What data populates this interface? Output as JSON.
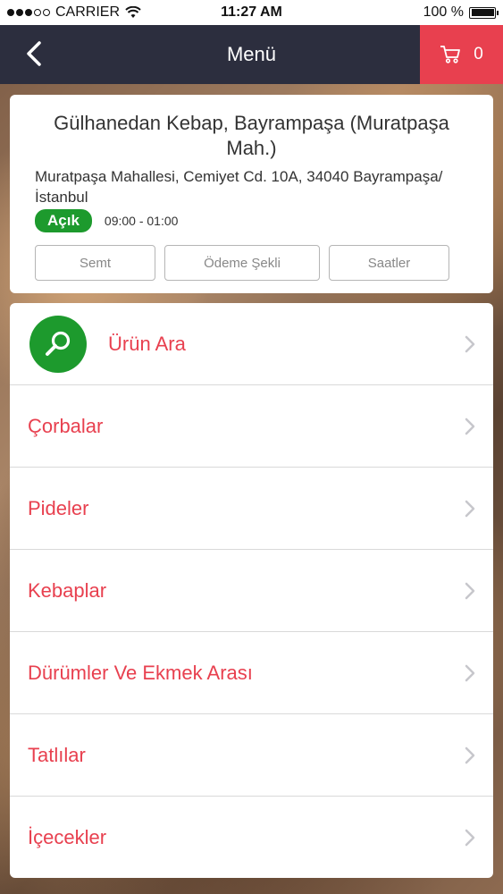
{
  "status_bar": {
    "carrier": "CARRIER",
    "time": "11:27 AM",
    "battery": "100 %"
  },
  "nav": {
    "title": "Menü",
    "cart_count": "0"
  },
  "restaurant": {
    "name": "Gülhanedan Kebap, Bayrampaşa (Muratpaşa Mah.)",
    "address": "Muratpaşa Mahallesi, Cemiyet Cd. 10A, 34040 Bayrampaşa/İstanbul",
    "status": "Açık",
    "hours": "09:00 - 01:00",
    "buttons": [
      "Semt",
      "Ödeme Şekli",
      "Saatler"
    ]
  },
  "menu": {
    "search_label": "Ürün Ara",
    "categories": [
      "Çorbalar",
      "Pideler",
      "Kebaplar",
      "Dürümler Ve Ekmek Arası",
      "Tatlılar",
      "İçecekler"
    ]
  },
  "colors": {
    "accent": "#e8404f",
    "nav_bg": "#2c2e3e",
    "open_green": "#1d9a2d"
  }
}
